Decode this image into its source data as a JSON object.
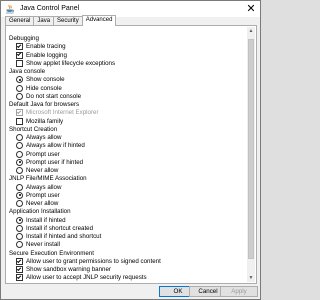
{
  "window": {
    "title": "Java Control Panel",
    "close_glyph": "✕"
  },
  "tabs": [
    "General",
    "Java",
    "Security",
    "Advanced"
  ],
  "active_tab": "Advanced",
  "settings": [
    {
      "kind": "category",
      "label": "Debugging"
    },
    {
      "kind": "checkbox",
      "label": "Enable tracing",
      "checked": true
    },
    {
      "kind": "checkbox",
      "label": "Enable logging",
      "checked": true
    },
    {
      "kind": "checkbox",
      "label": "Show applet lifecycle exceptions",
      "checked": false
    },
    {
      "kind": "category",
      "label": "Java console"
    },
    {
      "kind": "radio",
      "label": "Show console",
      "checked": true
    },
    {
      "kind": "radio",
      "label": "Hide console",
      "checked": false
    },
    {
      "kind": "radio",
      "label": "Do not start console",
      "checked": false
    },
    {
      "kind": "category",
      "label": "Default Java for browsers"
    },
    {
      "kind": "checkbox",
      "label": "Microsoft Internet Explorer",
      "checked": true,
      "disabled": true
    },
    {
      "kind": "checkbox",
      "label": "Mozilla family",
      "checked": false
    },
    {
      "kind": "category",
      "label": "Shortcut Creation"
    },
    {
      "kind": "radio",
      "label": "Always allow",
      "checked": false
    },
    {
      "kind": "radio",
      "label": "Always allow if hinted",
      "checked": false
    },
    {
      "kind": "radio",
      "label": "Prompt user",
      "checked": false
    },
    {
      "kind": "radio",
      "label": "Prompt user if hinted",
      "checked": true
    },
    {
      "kind": "radio",
      "label": "Never allow",
      "checked": false
    },
    {
      "kind": "category",
      "label": "JNLP File/MIME Association"
    },
    {
      "kind": "radio",
      "label": "Always allow",
      "checked": false
    },
    {
      "kind": "radio",
      "label": "Prompt user",
      "checked": true
    },
    {
      "kind": "radio",
      "label": "Never allow",
      "checked": false
    },
    {
      "kind": "category",
      "label": "Application Installation"
    },
    {
      "kind": "radio",
      "label": "Install if hinted",
      "checked": true
    },
    {
      "kind": "radio",
      "label": "Install if shortcut created",
      "checked": false
    },
    {
      "kind": "radio",
      "label": "Install if hinted and shortcut",
      "checked": false
    },
    {
      "kind": "radio",
      "label": "Never install",
      "checked": false
    },
    {
      "kind": "category",
      "label": "Secure Execution Environment"
    },
    {
      "kind": "checkbox",
      "label": "Allow user to grant permissions to signed content",
      "checked": true
    },
    {
      "kind": "checkbox",
      "label": "Show sandbox warning banner",
      "checked": true
    },
    {
      "kind": "checkbox",
      "label": "Allow user to accept JNLP security requests",
      "checked": true
    }
  ],
  "buttons": {
    "ok": "OK",
    "cancel": "Cancel",
    "apply": "Apply"
  },
  "scrollbar": {
    "up_glyph": "▲",
    "down_glyph": "▼"
  },
  "colors": {
    "accent": "#0078d7",
    "java_red": "#e76f00",
    "java_blue": "#5382a1"
  },
  "icons": {
    "app": "java-cup-icon"
  }
}
